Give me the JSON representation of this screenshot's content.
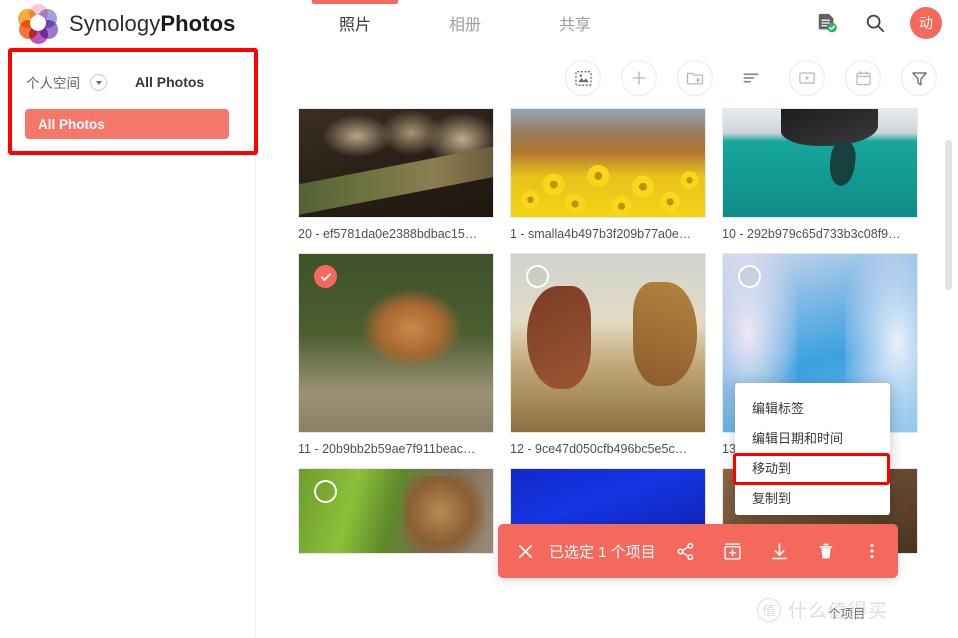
{
  "header": {
    "brand_first": "Synology",
    "brand_second": "Photos",
    "logo_icon": "synology-flower-logo",
    "tabs": [
      {
        "label": "照片",
        "name": "tab-photos",
        "active": true
      },
      {
        "label": "相册",
        "name": "tab-albums",
        "active": false
      },
      {
        "label": "共享",
        "name": "tab-shared",
        "active": false
      }
    ],
    "actions": {
      "notes_icon": "document-check-icon",
      "search_icon": "search-icon",
      "avatar_label": "动"
    },
    "active_tab_color": "#f4695c"
  },
  "sidebar": {
    "space_name": "个人空间",
    "space_dropdown_icon": "chevron-down-icon",
    "section_title": "All Photos",
    "nav_items": [
      {
        "label": "All Photos",
        "name": "sidebar-item-all-photos",
        "selected": true
      }
    ],
    "highlight_color": "#f4776a",
    "annotation_color": "#ff0000"
  },
  "toolbar": {
    "buttons": [
      {
        "name": "select-photos-icon",
        "icon": "dashed-image-icon"
      },
      {
        "name": "add-icon",
        "icon": "plus-icon"
      },
      {
        "name": "new-folder-icon",
        "icon": "folder-plus-icon"
      },
      {
        "name": "sort-icon",
        "icon": "sort-lines-icon"
      },
      {
        "name": "slideshow-icon",
        "icon": "play-rect-icon"
      },
      {
        "name": "calendar-icon",
        "icon": "calendar-icon"
      },
      {
        "name": "filter-icon",
        "icon": "funnel-icon"
      }
    ]
  },
  "grid": {
    "rows": [
      {
        "cells": [
          {
            "caption": "20 - ef5781da0e2388bdbac15…",
            "photo": "meerkat",
            "checkbox": "none",
            "name": "photo-cell-1"
          },
          {
            "caption": "1 - smalla4b497b3f209b77a0e…",
            "photo": "sunflower",
            "checkbox": "none",
            "name": "photo-cell-2"
          },
          {
            "caption": "10 - 292b979c65d733b3c08f9…",
            "photo": "penguin",
            "checkbox": "none",
            "name": "photo-cell-3"
          }
        ]
      },
      {
        "cells": [
          {
            "caption": "11 - 20b9bb2b59ae7f911beac…",
            "photo": "squirrel",
            "checkbox": "checked",
            "name": "photo-cell-4"
          },
          {
            "caption": "12 - 9ce47d050cfb496bc5e5c…",
            "photo": "horses",
            "checkbox": "unchecked",
            "name": "photo-cell-5"
          },
          {
            "caption": "13",
            "photo": "frost",
            "checkbox": "unchecked",
            "name": "photo-cell-6"
          }
        ]
      },
      {
        "cells": [
          {
            "caption": "",
            "photo": "fern",
            "checkbox": "unchecked",
            "name": "photo-cell-7"
          },
          {
            "caption": "",
            "photo": "blue",
            "checkbox": "none",
            "name": "photo-cell-8"
          },
          {
            "caption": "",
            "photo": "brown",
            "checkbox": "none",
            "name": "photo-cell-9"
          }
        ]
      }
    ]
  },
  "context_menu": {
    "items": [
      {
        "label": "编辑标签",
        "name": "menu-item-edit-tags",
        "highlighted": false
      },
      {
        "label": "编辑日期和时间",
        "name": "menu-item-edit-datetime",
        "highlighted": false
      },
      {
        "label": "移动到",
        "name": "menu-item-move-to",
        "highlighted": true
      },
      {
        "label": "复制到",
        "name": "menu-item-copy-to",
        "highlighted": false
      }
    ],
    "highlight_color": "#ff0000"
  },
  "action_bar": {
    "close_icon": "close-icon",
    "status_text": "已选定 1 个项目",
    "background_color": "#f4695c",
    "icons": [
      {
        "name": "share-icon",
        "icon": "share-nodes-icon"
      },
      {
        "name": "add-to-album-icon",
        "icon": "album-plus-icon"
      },
      {
        "name": "download-icon",
        "icon": "download-arrow-icon"
      },
      {
        "name": "delete-icon",
        "icon": "trash-icon"
      },
      {
        "name": "more-options-icon",
        "icon": "dots-vertical-icon"
      }
    ]
  },
  "footer": {
    "item_count_text": "个项目"
  },
  "watermark": {
    "badge": "值",
    "text": "什么值得买"
  }
}
